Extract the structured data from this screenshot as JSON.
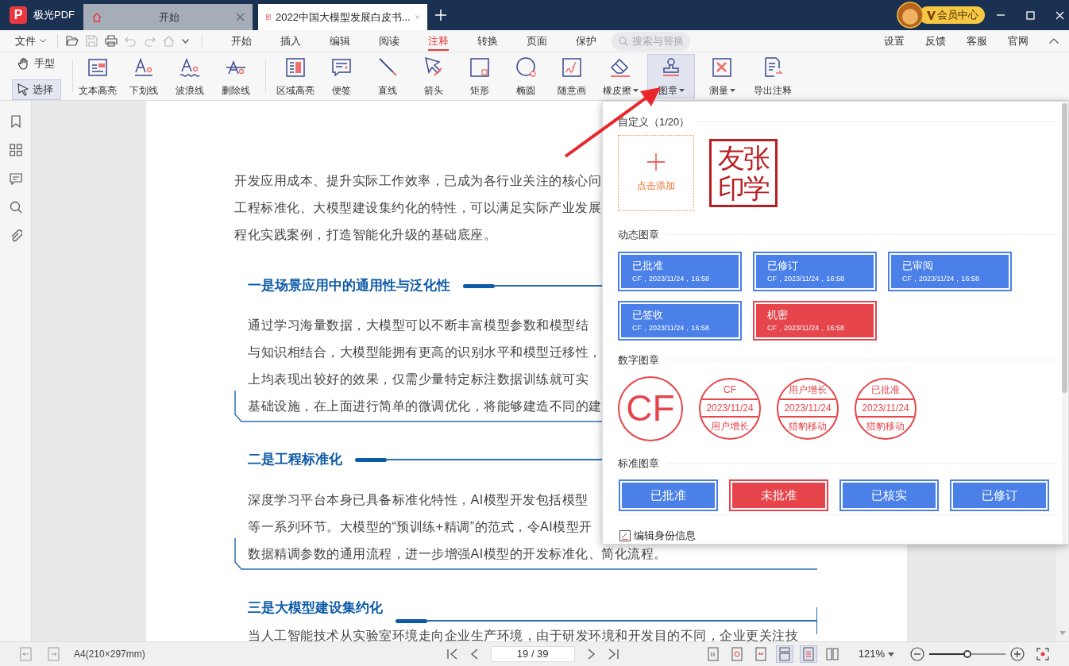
{
  "app": {
    "logo": "P",
    "name": "极光PDF"
  },
  "tabs": [
    {
      "label": "开始",
      "selected": false
    },
    {
      "label": "2022中国大模型发展白皮书...",
      "selected": true
    }
  ],
  "member": {
    "label": "会员中心"
  },
  "menu": {
    "file": "文件",
    "tabs": [
      {
        "label": "开始",
        "selected": false
      },
      {
        "label": "插入",
        "selected": false
      },
      {
        "label": "编辑",
        "selected": false
      },
      {
        "label": "阅读",
        "selected": false
      },
      {
        "label": "注释",
        "selected": true
      },
      {
        "label": "转换",
        "selected": false
      },
      {
        "label": "页面",
        "selected": false
      },
      {
        "label": "保护",
        "selected": false
      }
    ],
    "search_placeholder": "搜索与替换",
    "links": [
      "设置",
      "反馈",
      "客服",
      "官网"
    ]
  },
  "toolbar": {
    "modes": [
      {
        "label": "手型",
        "selected": false
      },
      {
        "label": "选择",
        "selected": true
      }
    ],
    "groups": [
      {
        "tools": [
          {
            "label": "文本高亮",
            "selected": false,
            "dropdown": false
          },
          {
            "label": "下划线",
            "selected": false,
            "dropdown": false
          },
          {
            "label": "波浪线",
            "selected": false,
            "dropdown": false
          },
          {
            "label": "删除线",
            "selected": false,
            "dropdown": false
          }
        ]
      },
      {
        "tools": [
          {
            "label": "区域高亮",
            "selected": false,
            "dropdown": false
          },
          {
            "label": "便签",
            "selected": false,
            "dropdown": false
          },
          {
            "label": "直线",
            "selected": false,
            "dropdown": false
          },
          {
            "label": "箭头",
            "selected": false,
            "dropdown": false
          },
          {
            "label": "矩形",
            "selected": false,
            "dropdown": false
          },
          {
            "label": "椭圆",
            "selected": false,
            "dropdown": false
          },
          {
            "label": "随意画",
            "selected": false,
            "dropdown": false
          },
          {
            "label": "橡皮擦",
            "selected": false,
            "dropdown": true
          },
          {
            "label": "图章",
            "selected": true,
            "dropdown": true
          },
          {
            "label": "测量",
            "selected": false,
            "dropdown": true
          },
          {
            "label": "导出注释",
            "selected": false,
            "dropdown": false
          }
        ]
      }
    ]
  },
  "document": {
    "blocks": [
      {
        "kind": "paragraph",
        "lines": [
          "开发应用成本、提升实际工作效率，已成为各行业关注的核心问",
          "工程标准化、大模型建设集约化的特性，可以满足实际产业发展",
          "程化实践案例，打造智能化升级的基础底座。"
        ]
      },
      {
        "kind": "heading",
        "text": "一是场景应用中的通用性与泛化性"
      },
      {
        "kind": "boxed",
        "lines": [
          "通过学习海量数据，大模型可以不断丰富模型参数和模型结",
          "与知识相结合，大模型能拥有更高的识别水平和模型迁移性，",
          "上均表现出较好的效果，仅需少量特定标注数据训练就可实",
          "基础设施，在上面进行简单的微调优化，将能够建造不同的建"
        ]
      },
      {
        "kind": "heading",
        "text": "二是工程标准化"
      },
      {
        "kind": "boxed",
        "lines": [
          "深度学习平台本身已具备标准化特性，AI模型开发包括模型",
          "等一系列环节。大模型的“预训练+精调”的范式，令AI模型开",
          "数据精调参数的通用流程，进一步增强AI模型的开发标准化、简化流程。"
        ]
      },
      {
        "kind": "heading",
        "text": "三是大模型建设集约化"
      },
      {
        "kind": "indented",
        "lines": [
          "当人工智能技术从实验室环境走向企业生产环境，由于研发环境和开发目的不同，企业更关注技"
        ]
      }
    ]
  },
  "stamp_panel": {
    "sections": [
      {
        "kind": "custom",
        "title": "自定义（1/20）",
        "add_label": "点击添加",
        "seal": [
          "友张",
          "印学"
        ]
      },
      {
        "kind": "dynamic",
        "title": "动态图章",
        "stamps": [
          {
            "title": "已批准",
            "detail": "CF，2023/11/24，16:58",
            "color": "#4a80e8"
          },
          {
            "title": "已修订",
            "detail": "CF，2023/11/24，16:58",
            "color": "#4a80e8"
          },
          {
            "title": "已审阅",
            "detail": "CF，2023/11/24，16:58",
            "color": "#4a80e8"
          },
          {
            "title": "已签收",
            "detail": "CF，2023/11/24，16:58",
            "color": "#4a80e8"
          },
          {
            "title": "机密",
            "detail": "CF，2023/11/24，16:58",
            "color": "#e5454b"
          }
        ]
      },
      {
        "kind": "digital",
        "title": "数字图章",
        "stamps": [
          {
            "kind": "single",
            "text": "CF"
          },
          {
            "kind": "triple",
            "top": "CF",
            "middle": "2023/11/24",
            "bottom": "用户增长"
          },
          {
            "kind": "triple",
            "top": "用户增长",
            "middle": "2023/11/24",
            "bottom": "猎豹移动"
          },
          {
            "kind": "triple",
            "top": "已批准",
            "middle": "2023/11/24",
            "bottom": "猎豹移动"
          }
        ]
      },
      {
        "kind": "standard",
        "title": "标准图章",
        "stamps": [
          {
            "label": "已批准",
            "color": "#4a80e8"
          },
          {
            "label": "未批准",
            "color": "#e5454b"
          },
          {
            "label": "已核实",
            "color": "#4a80e8"
          },
          {
            "label": "已修订",
            "color": "#4a80e8"
          }
        ]
      }
    ],
    "footer": "编辑身份信息"
  },
  "status_bar": {
    "paper": "A4(210×297mm)",
    "page": "19 / 39",
    "zoom": "121%",
    "zoom_slider": {
      "level": 0.5
    },
    "view_modes": [
      {
        "selected": false
      },
      {
        "selected": false
      },
      {
        "selected": false
      },
      {
        "selected": true
      },
      {
        "selected": true
      },
      {
        "selected": false
      }
    ]
  }
}
